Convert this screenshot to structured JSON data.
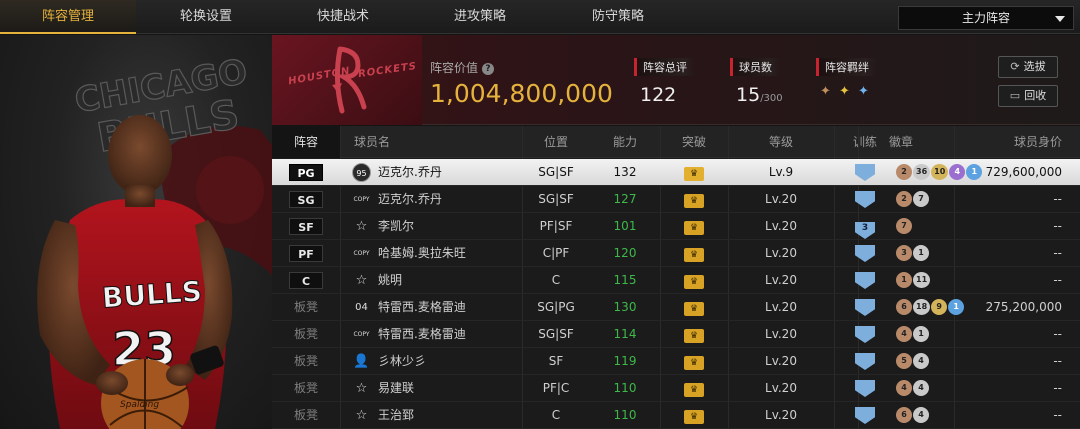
{
  "tabs": [
    "阵容管理",
    "轮换设置",
    "快捷战术",
    "进攻策略",
    "防守策略"
  ],
  "lineup_select": "主力阵容",
  "team": {
    "name": "ROCKETS",
    "city": "HOUSTON",
    "value_label": "阵容价值",
    "value": "1,004,800,000",
    "rating_label": "阵容总评",
    "rating": "122",
    "players_label": "球员数",
    "players_count": "15",
    "players_max": "/300",
    "bonds_label": "阵容羁绊",
    "btn_select": "选拔",
    "btn_recycle": "回收"
  },
  "columns": [
    "阵容",
    "球员名",
    "位置",
    "能力",
    "突破",
    "等级",
    "训练",
    "徽章",
    "球员身价"
  ],
  "rows": [
    {
      "slot": "PG",
      "icon": "95",
      "name": "迈克尔.乔丹",
      "pos": "SG|SF",
      "ability": "132",
      "level": "Lv.9",
      "train": "",
      "badges": [
        [
          "2",
          "bronze"
        ],
        [
          "36",
          "silver"
        ],
        [
          "10",
          "gold"
        ],
        [
          "4",
          "purple"
        ],
        [
          "1",
          "blue"
        ]
      ],
      "value": "729,600,000"
    },
    {
      "slot": "SG",
      "icon": "COPY",
      "name": "迈克尔.乔丹",
      "pos": "SG|SF",
      "ability": "127",
      "level": "Lv.20",
      "train": "",
      "badges": [
        [
          "2",
          "bronze"
        ],
        [
          "7",
          "silver"
        ]
      ],
      "value": "--"
    },
    {
      "slot": "SF",
      "icon": "star",
      "name": "李凯尔",
      "pos": "PF|SF",
      "ability": "101",
      "level": "Lv.20",
      "train": "3",
      "badges": [
        [
          "7",
          "bronze"
        ]
      ],
      "value": "--"
    },
    {
      "slot": "PF",
      "icon": "COPY",
      "name": "哈基姆.奥拉朱旺",
      "pos": "C|PF",
      "ability": "120",
      "level": "Lv.20",
      "train": "",
      "badges": [
        [
          "3",
          "bronze"
        ],
        [
          "1",
          "silver"
        ]
      ],
      "value": "--"
    },
    {
      "slot": "C",
      "icon": "star",
      "name": "姚明",
      "pos": "C",
      "ability": "115",
      "level": "Lv.20",
      "train": "",
      "badges": [
        [
          "1",
          "bronze"
        ],
        [
          "11",
          "silver"
        ]
      ],
      "value": "--"
    },
    {
      "slot": "板凳",
      "icon": "04",
      "name": "特雷西.麦格雷迪",
      "pos": "SG|PG",
      "ability": "130",
      "level": "Lv.20",
      "train": "",
      "badges": [
        [
          "6",
          "bronze"
        ],
        [
          "18",
          "silver"
        ],
        [
          "9",
          "gold"
        ],
        [
          "1",
          "blue"
        ]
      ],
      "value": "275,200,000"
    },
    {
      "slot": "板凳",
      "icon": "COPY",
      "name": "特雷西.麦格雷迪",
      "pos": "SG|SF",
      "ability": "114",
      "level": "Lv.20",
      "train": "",
      "badges": [
        [
          "4",
          "bronze"
        ],
        [
          "1",
          "silver"
        ]
      ],
      "value": "--"
    },
    {
      "slot": "板凳",
      "icon": "person",
      "name": "彡林少彡",
      "pos": "SF",
      "ability": "119",
      "level": "Lv.20",
      "train": "",
      "badges": [
        [
          "5",
          "bronze"
        ],
        [
          "4",
          "silver"
        ]
      ],
      "value": "--"
    },
    {
      "slot": "板凳",
      "icon": "star",
      "name": "易建联",
      "pos": "PF|C",
      "ability": "110",
      "level": "Lv.20",
      "train": "",
      "badges": [
        [
          "4",
          "bronze"
        ],
        [
          "4",
          "silver"
        ]
      ],
      "value": "--"
    },
    {
      "slot": "板凳",
      "icon": "star",
      "name": "王治郅",
      "pos": "C",
      "ability": "110",
      "level": "Lv.20",
      "train": "",
      "badges": [
        [
          "6",
          "bronze"
        ],
        [
          "4",
          "silver"
        ]
      ],
      "value": "--"
    }
  ],
  "art": {
    "bg_text_1": "CHICAGO",
    "bg_text_2": "BULLS",
    "jersey_text": "BULLS",
    "jersey_number": "23",
    "ball_text": "Spalding"
  }
}
